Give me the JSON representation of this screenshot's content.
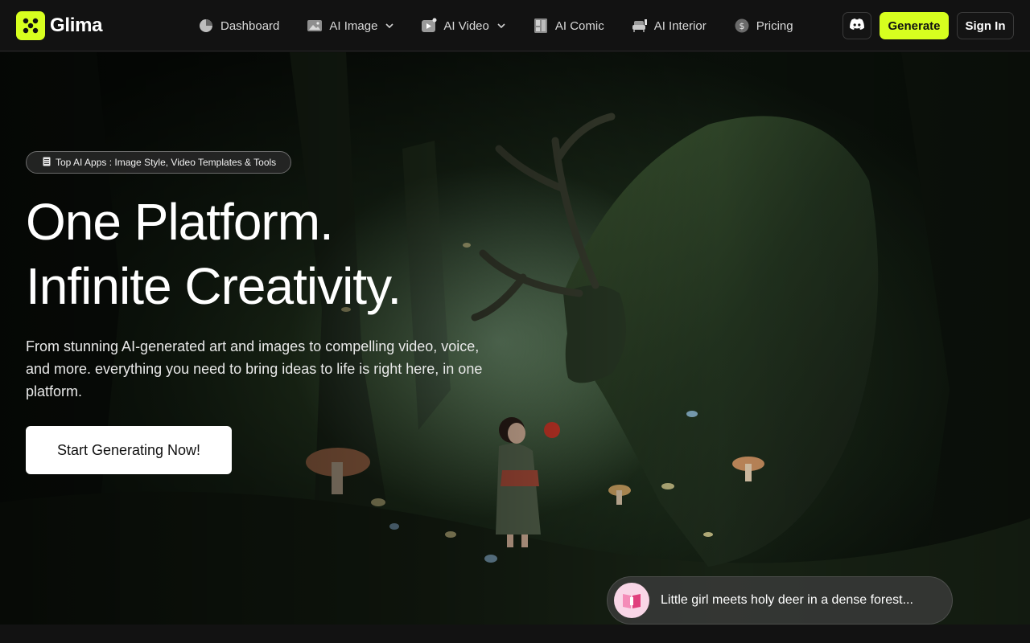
{
  "brand": {
    "name": "Glima",
    "accent": "#d7ff1f"
  },
  "nav": {
    "items": [
      {
        "label": "Dashboard",
        "icon": "pie-chart-icon",
        "dropdown": false
      },
      {
        "label": "AI Image",
        "icon": "image-icon",
        "dropdown": true
      },
      {
        "label": "AI Video",
        "icon": "video-icon",
        "dropdown": true
      },
      {
        "label": "AI Comic",
        "icon": "comic-book-icon",
        "dropdown": false
      },
      {
        "label": "AI Interior",
        "icon": "sofa-icon",
        "dropdown": false
      },
      {
        "label": "Pricing",
        "icon": "dollar-coin-icon",
        "dropdown": false
      }
    ],
    "discord_icon": "discord-icon",
    "generate_label": "Generate",
    "signin_label": "Sign In"
  },
  "hero": {
    "pill_label": "Top AI Apps : Image Style, Video Templates & Tools",
    "title_line1": "One Platform.",
    "title_line2": "Infinite Creativity.",
    "subtitle": "From stunning AI-generated art and images to compelling video, voice, and more. everything you need to bring ideas to life is right here, in one platform.",
    "cta_label": "Start Generating Now!",
    "caption": "Little girl meets holy deer in a dense forest..."
  }
}
